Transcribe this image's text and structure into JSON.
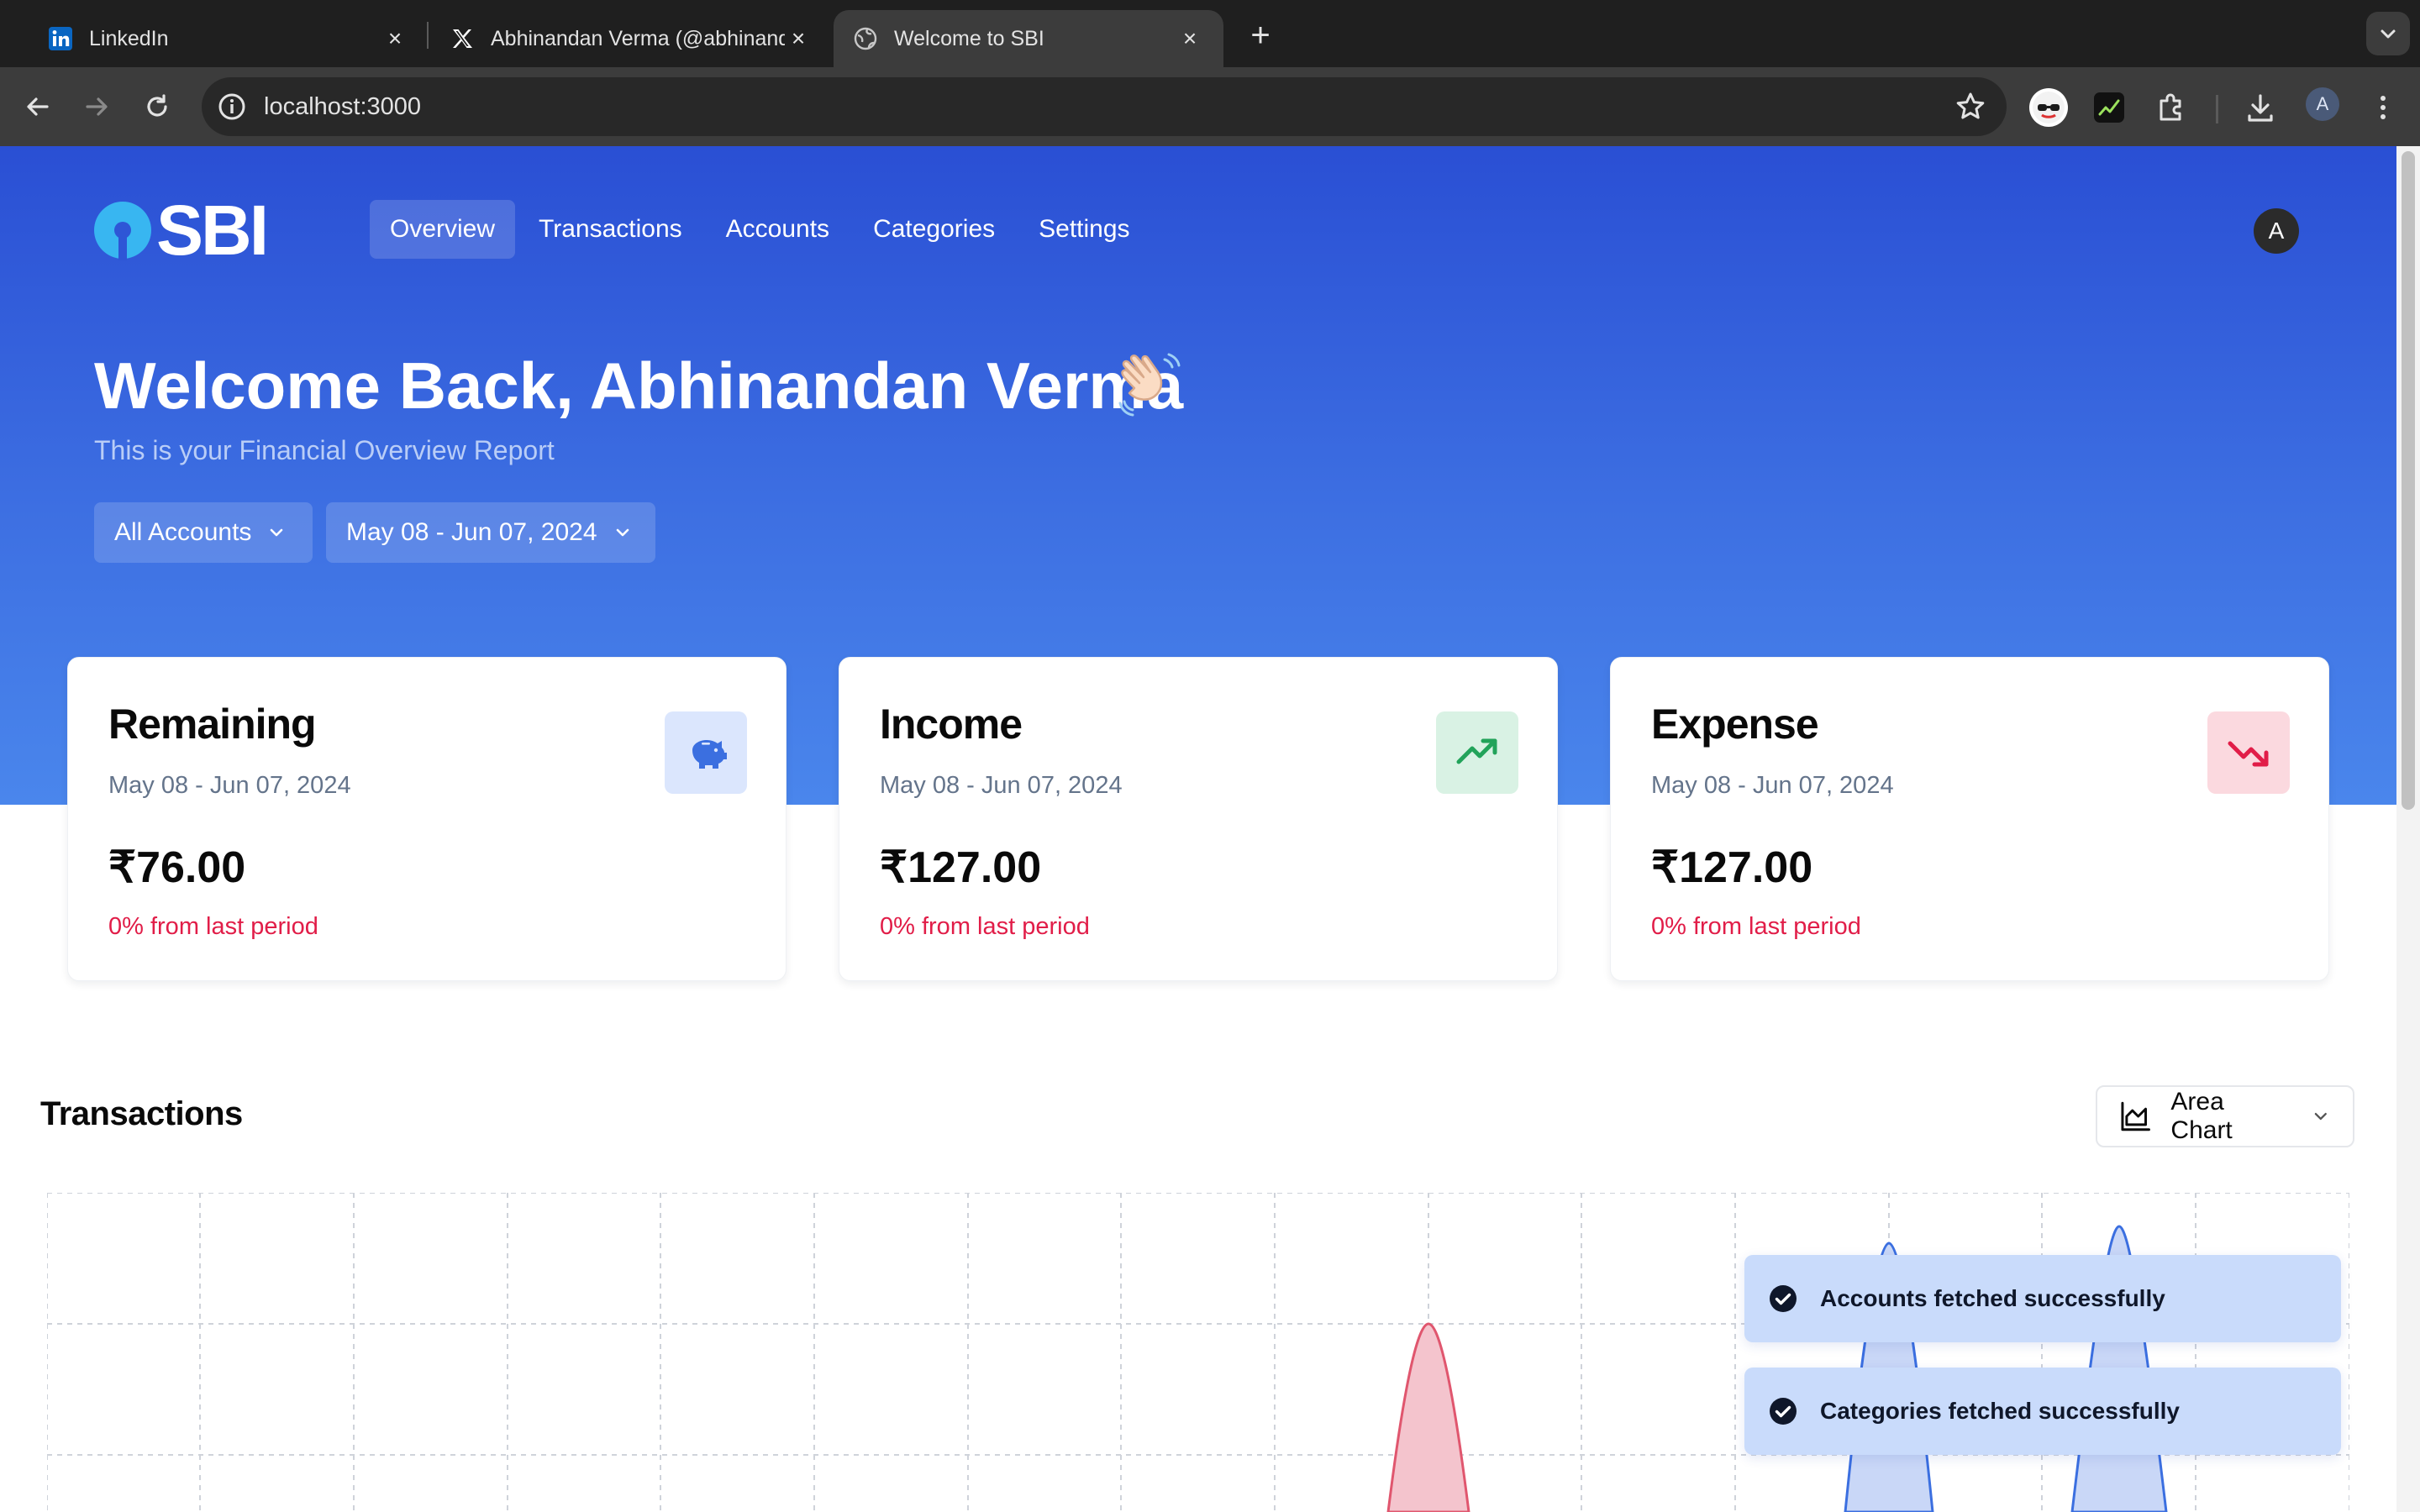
{
  "browser": {
    "tabs": [
      {
        "title": "LinkedIn",
        "icon": "linkedin-icon"
      },
      {
        "title": "Abhinandan Verma (@abhinandan",
        "icon": "x-logo-icon"
      },
      {
        "title": "Welcome to SBI",
        "icon": "globe-icon"
      }
    ],
    "url": "localhost:3000",
    "profile_initial": "A"
  },
  "app": {
    "logo_text": "SBI",
    "nav": [
      "Overview",
      "Transactions",
      "Accounts",
      "Categories",
      "Settings"
    ],
    "active_nav": "Overview",
    "avatar_initial": "A"
  },
  "hero": {
    "welcome": "Welcome Back, Abhinandan Verma",
    "wave_emoji": "👋🏻",
    "subtitle": "This is your Financial Overview Report",
    "account_filter": "All Accounts",
    "date_filter": "May 08 - Jun 07, 2024"
  },
  "cards": [
    {
      "title": "Remaining",
      "range": "May 08 - Jun 07, 2024",
      "amount": "₹76.00",
      "change": "0% from last period",
      "icon": "piggy-bank-icon",
      "icon_bg": "#dbe6fd",
      "icon_color": "#3b6fe0"
    },
    {
      "title": "Income",
      "range": "May 08 - Jun 07, 2024",
      "amount": "₹127.00",
      "change": "0% from last period",
      "icon": "trending-up-icon",
      "icon_bg": "#d9f2e4",
      "icon_color": "#22a35a"
    },
    {
      "title": "Expense",
      "range": "May 08 - Jun 07, 2024",
      "amount": "₹127.00",
      "change": "0% from last period",
      "icon": "trending-down-icon",
      "icon_bg": "#fbd9df",
      "icon_color": "#e11d48"
    }
  ],
  "transactions": {
    "title": "Transactions",
    "chart_type_label": "Area Chart"
  },
  "toasts": [
    "Accounts fetched successfully",
    "Categories fetched successfully"
  ],
  "colors": {
    "primary": "#2a4fd4",
    "income": "#3b6fe0",
    "expense": "#e11d48"
  }
}
